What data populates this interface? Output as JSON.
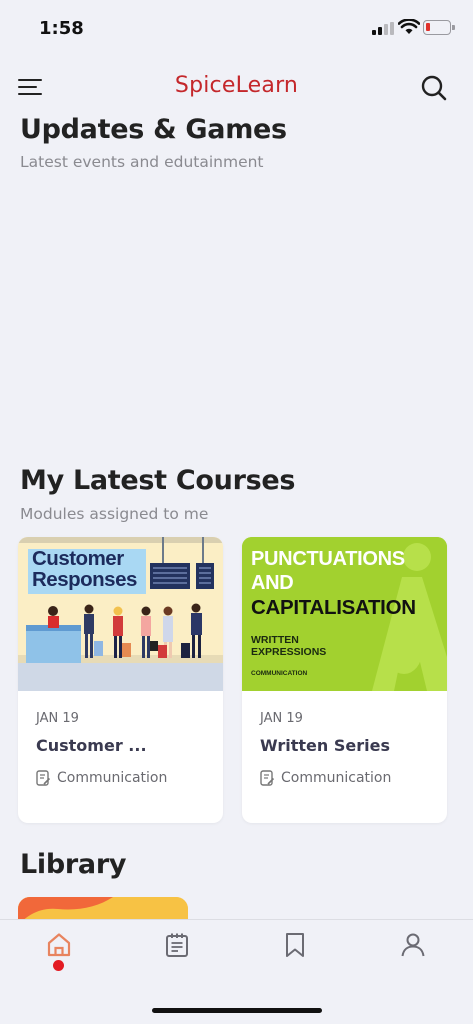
{
  "status_bar": {
    "time": "1:58"
  },
  "header": {
    "title": "SpiceLearn",
    "title_color": "#c4272b"
  },
  "updates": {
    "title": "Updates & Games",
    "subtitle": "Latest events and edutainment"
  },
  "courses": {
    "title": "My Latest Courses",
    "subtitle": "Modules assigned to me",
    "items": [
      {
        "thumb_text": [
          "Customer",
          "Responses"
        ],
        "date": "JAN 19",
        "title": "Customer ...",
        "category": "Communication"
      },
      {
        "thumb_text": [
          "PUNCTUATIONS",
          "AND",
          "CAPITALISATION",
          "WRITTEN",
          "EXPRESSIONS",
          "COMMUNICATION"
        ],
        "date": "JAN 19",
        "title": "Written Series",
        "category": "Communication"
      }
    ]
  },
  "library": {
    "title": "Library"
  },
  "tab_bar": {
    "tabs": [
      "home-icon",
      "notes-icon",
      "bookmark-icon",
      "profile-icon"
    ],
    "active": 0,
    "active_color": "#e8845f",
    "dot_color": "#e31b23"
  }
}
